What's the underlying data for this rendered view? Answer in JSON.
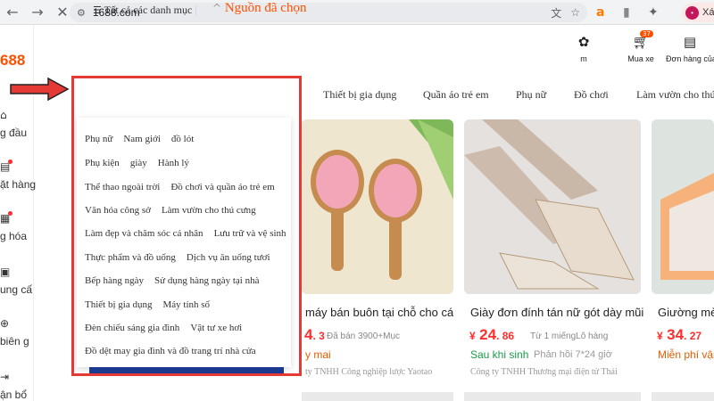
{
  "browser": {
    "url": "1688.com",
    "profile_label": "Xá"
  },
  "sidebar": {
    "logo": "688",
    "items": [
      {
        "label": "g đầu",
        "icon": "home-icon"
      },
      {
        "label": "ặt hàng",
        "icon": "order-icon"
      },
      {
        "label": "g hóa",
        "icon": "grid-icon"
      },
      {
        "label": "ung cấ",
        "icon": "supplier-icon"
      },
      {
        "label": "biên g",
        "icon": "globe-icon"
      },
      {
        "label": "ận bổ",
        "icon": "arrow-in-icon"
      }
    ]
  },
  "header": {
    "icons": [
      {
        "label": "m",
        "icon": "puzzle-icon"
      },
      {
        "label": "Mua xe",
        "icon": "cart-icon",
        "badge": "37"
      },
      {
        "label": "Đơn hàng của",
        "icon": "clipboard-icon"
      }
    ]
  },
  "categories": {
    "all_label": "Tất cả các danh mục",
    "source_label": "Nguồn đã chọn",
    "tabs": [
      "Thiết bị gia dụng",
      "Quần áo trẻ em",
      "Phụ nữ",
      "Đồ chơi",
      "Làm vườn cho thú"
    ]
  },
  "dropdown": {
    "rows": [
      [
        "Phụ nữ",
        "Nam giới",
        "đồ lót"
      ],
      [
        "Phụ kiện",
        "giày",
        "Hành lý"
      ],
      [
        "Thể thao ngoài trời",
        "Đồ chơi và quần áo trẻ em"
      ],
      [
        "Văn hóa công sở",
        "Làm vườn cho thú cưng"
      ],
      [
        "Làm đẹp và chăm sóc cá nhân",
        "Lưu trữ và vệ sinh"
      ],
      [
        "Thực phẩm và đồ uống",
        "Dịch vụ ăn uống tươi"
      ],
      [
        "Bếp hàng ngày",
        "Sử dụng hàng ngày tại nhà"
      ],
      [
        "Thiết bị gia dụng",
        "Máy tính số"
      ],
      [
        "Đèn chiếu sáng gia đình",
        "Vật tư xe hơi"
      ],
      [
        "Đồ dệt may gia đình và đồ trang trí nhà cửa"
      ]
    ]
  },
  "products": [
    {
      "title": "máy bán buôn tại chỗ cho cá...",
      "price_int": "4",
      "price_dec": ". 3",
      "meta": "Đã bán 3900+Mục",
      "ship": "y mai",
      "company": "ty TNHH Công nghiệp lược Yaotao"
    },
    {
      "title": "Giày đơn đính tán nữ gót dày mũi...",
      "currency": "¥",
      "price_int": "24",
      "price_dec": ". 86",
      "meta": "Từ 1 miếngLô hàng",
      "ship": "Sau khi sinh",
      "ship_extra": "Phản hồi 7*24 giờ",
      "company": "Công ty TNHH Thương mại điện tử Thái"
    },
    {
      "title": "Giường mèo",
      "currency": "¥",
      "price_int": "34",
      "price_dec": ". 27",
      "ship": "Miễn phí vận"
    }
  ]
}
